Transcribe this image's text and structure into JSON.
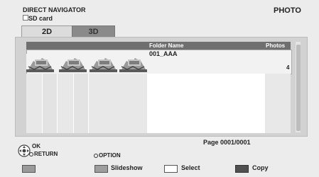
{
  "header": {
    "title": "DIRECT NAVIGATOR",
    "mode": "PHOTO",
    "source_label": "SD card"
  },
  "tabs": [
    {
      "label": "2D",
      "selected": true
    },
    {
      "label": "3D",
      "selected": false
    }
  ],
  "list": {
    "columns": {
      "folder": "Folder Name",
      "photos": "Photos"
    },
    "rows": [
      {
        "folder_name": "001_AAA",
        "photos": "4",
        "thumbnail_count": 4
      }
    ]
  },
  "footer": {
    "page": "Page  0001/0001",
    "ok": "OK",
    "return": "RETURN",
    "option": "OPTION",
    "keys": [
      {
        "color": "red",
        "label": ""
      },
      {
        "color": "green",
        "label": "Slideshow"
      },
      {
        "color": "yellow",
        "label": "Select"
      },
      {
        "color": "blue",
        "label": "Copy"
      }
    ]
  },
  "colors": {
    "background": "#ececec",
    "panel": "#d2d2d2",
    "list_header": "#6f6f6f",
    "selected_row": "#f2f2f2"
  }
}
